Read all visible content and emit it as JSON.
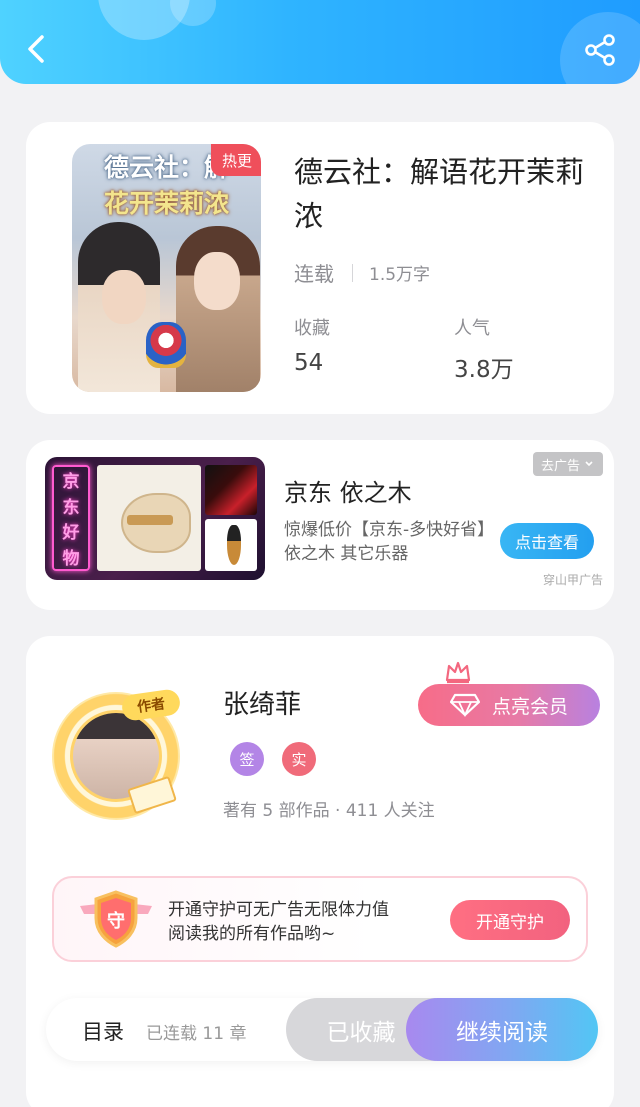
{
  "book": {
    "cover_title_line1": "德云社：解",
    "cover_title_line2": "花开茉莉浓",
    "tag": "热更",
    "title": "德云社：解语花开茉莉浓",
    "status": "连载",
    "word_count": "1.5万字",
    "favorites_label": "收藏",
    "favorites_value": "54",
    "popularity_label": "人气",
    "popularity_value": "3.8万"
  },
  "ad": {
    "image_text": [
      "京",
      "东",
      "好",
      "物"
    ],
    "title": "京东 依之木",
    "description": "惊爆低价【京东-多快好省】依之木 其它乐器",
    "close_label": "去广告",
    "cta_label": "点击查看",
    "source": "穿山甲广告"
  },
  "author": {
    "badge_label": "作者",
    "name": "张绮菲",
    "vip_label": "点亮会员",
    "sign_badge": "签",
    "real_badge": "实",
    "stats": "著有 5 部作品 · 411 人关注"
  },
  "guard": {
    "icon_label": "守",
    "line1": "开通守护可无广告无限体力值",
    "line2": "阅读我的所有作品哟~",
    "button_label": "开通守护"
  },
  "bottom_bar": {
    "toc_label": "目录",
    "toc_status": "已连载 11 章",
    "collected_label": "已收藏",
    "read_label": "继续阅读"
  },
  "icons": {
    "back": "back-arrow-icon",
    "share": "share-icon",
    "crown": "crown-icon",
    "diamond": "diamond-icon",
    "shield": "shield-icon",
    "chevron": "chevron-down-icon"
  },
  "colors": {
    "header_start": "#4fd2ff",
    "header_end": "#1f9cff",
    "hot_tag": "#ef4f5b",
    "read_start": "#a889ef",
    "read_end": "#52c6f4"
  }
}
